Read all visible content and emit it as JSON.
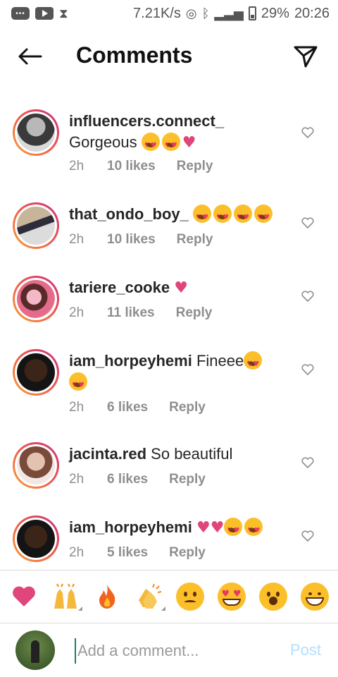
{
  "status_bar": {
    "speed": "7.21K/s",
    "battery": "29%",
    "time": "20:26"
  },
  "header": {
    "title": "Comments"
  },
  "comments": [
    {
      "username": "influencers.connect_",
      "text": "Gorgeous",
      "time": "2h",
      "likes": "10 likes",
      "reply": "Reply"
    },
    {
      "username": "that_ondo_boy_",
      "text": "",
      "time": "2h",
      "likes": "10 likes",
      "reply": "Reply"
    },
    {
      "username": "tariere_cooke",
      "text": "",
      "time": "2h",
      "likes": "11 likes",
      "reply": "Reply"
    },
    {
      "username": "iam_horpeyhemi",
      "text": "Fineee",
      "time": "2h",
      "likes": "6 likes",
      "reply": "Reply"
    },
    {
      "username": "jacinta.red",
      "text": "So beautiful",
      "time": "2h",
      "likes": "6 likes",
      "reply": "Reply"
    },
    {
      "username": "iam_horpeyhemi",
      "text": "",
      "time": "2h",
      "likes": "5 likes",
      "reply": "Reply"
    }
  ],
  "emoji_bar": [
    "heart",
    "raised-hands",
    "fire",
    "clapping-hands",
    "sad-face",
    "heart-eyes-face",
    "surprised-face",
    "grinning-face"
  ],
  "composer": {
    "placeholder": "Add a comment...",
    "post_label": "Post"
  },
  "colors": {
    "accent_blue_disabled": "#b2dffc",
    "heart_pink": "#e0457b",
    "story_ring_start": "#f9a23a",
    "story_ring_end": "#c9307f"
  }
}
